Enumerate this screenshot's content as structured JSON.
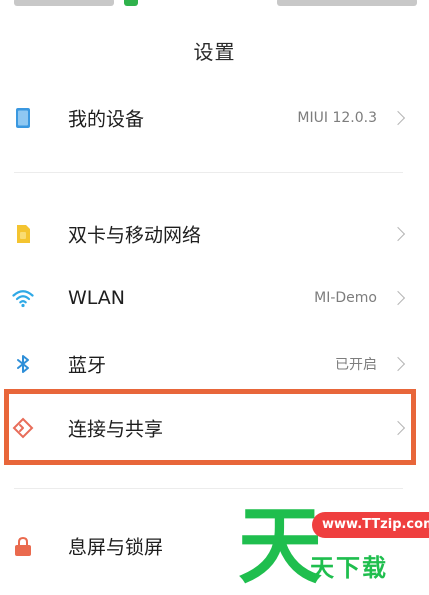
{
  "title": "设置",
  "colors": {
    "accent_highlight": "#e8663a",
    "device_icon": "#3a98e0",
    "sim_icon": "#f4c430",
    "wifi_icon": "#2fa9e6",
    "bluetooth_icon": "#2f8fd8",
    "share_icon": "#e86d5a",
    "lock_icon": "#ea6a4e",
    "watermark_green": "#1fbe4e",
    "watermark_red": "#ef3f3f"
  },
  "items": [
    {
      "label": "我的设备",
      "value": "MIUI 12.0.3",
      "icon": "phone-device-icon"
    },
    {
      "label": "双卡与移动网络",
      "value": "",
      "icon": "sim-card-icon"
    },
    {
      "label": "WLAN",
      "value": "MI-Demo",
      "icon": "wifi-icon"
    },
    {
      "label": "蓝牙",
      "value": "已开启",
      "icon": "bluetooth-icon"
    },
    {
      "label": "连接与共享",
      "value": "",
      "icon": "connection-share-icon"
    },
    {
      "label": "息屏与锁屏",
      "value": "",
      "icon": "lock-icon"
    }
  ],
  "watermark": {
    "big": "天",
    "url": "www.TTzip.com",
    "small": "天下载"
  }
}
